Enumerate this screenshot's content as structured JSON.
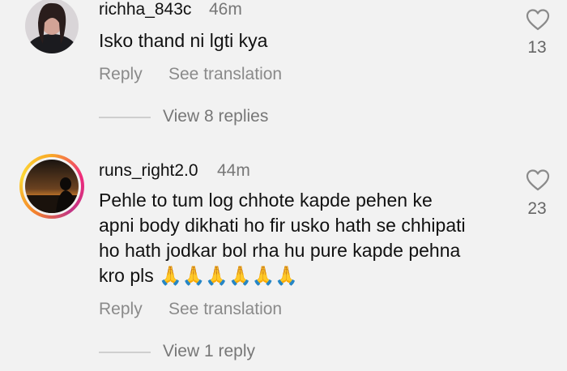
{
  "comments": [
    {
      "username": "richha_843c",
      "time": "46m",
      "text": "Isko thand ni lgti kya",
      "reply_label": "Reply",
      "translate_label": "See translation",
      "view_replies": "View 8 replies",
      "like_count": "13"
    },
    {
      "username": "runs_right2.0",
      "time": "44m",
      "text": "Pehle to tum log chhote kapde pehen ke apni body dikhati ho fir usko hath se chhipati ho hath jodkar bol rha hu pure kapde pehna kro pls 🙏🙏🙏🙏🙏🙏",
      "reply_label": "Reply",
      "translate_label": "See translation",
      "view_replies": "View 1 reply",
      "like_count": "23"
    }
  ],
  "colors": {
    "background": "#f2f2f2",
    "story_ring": "#ee2a7b"
  },
  "icons": {
    "like": "heart-outline-icon"
  }
}
